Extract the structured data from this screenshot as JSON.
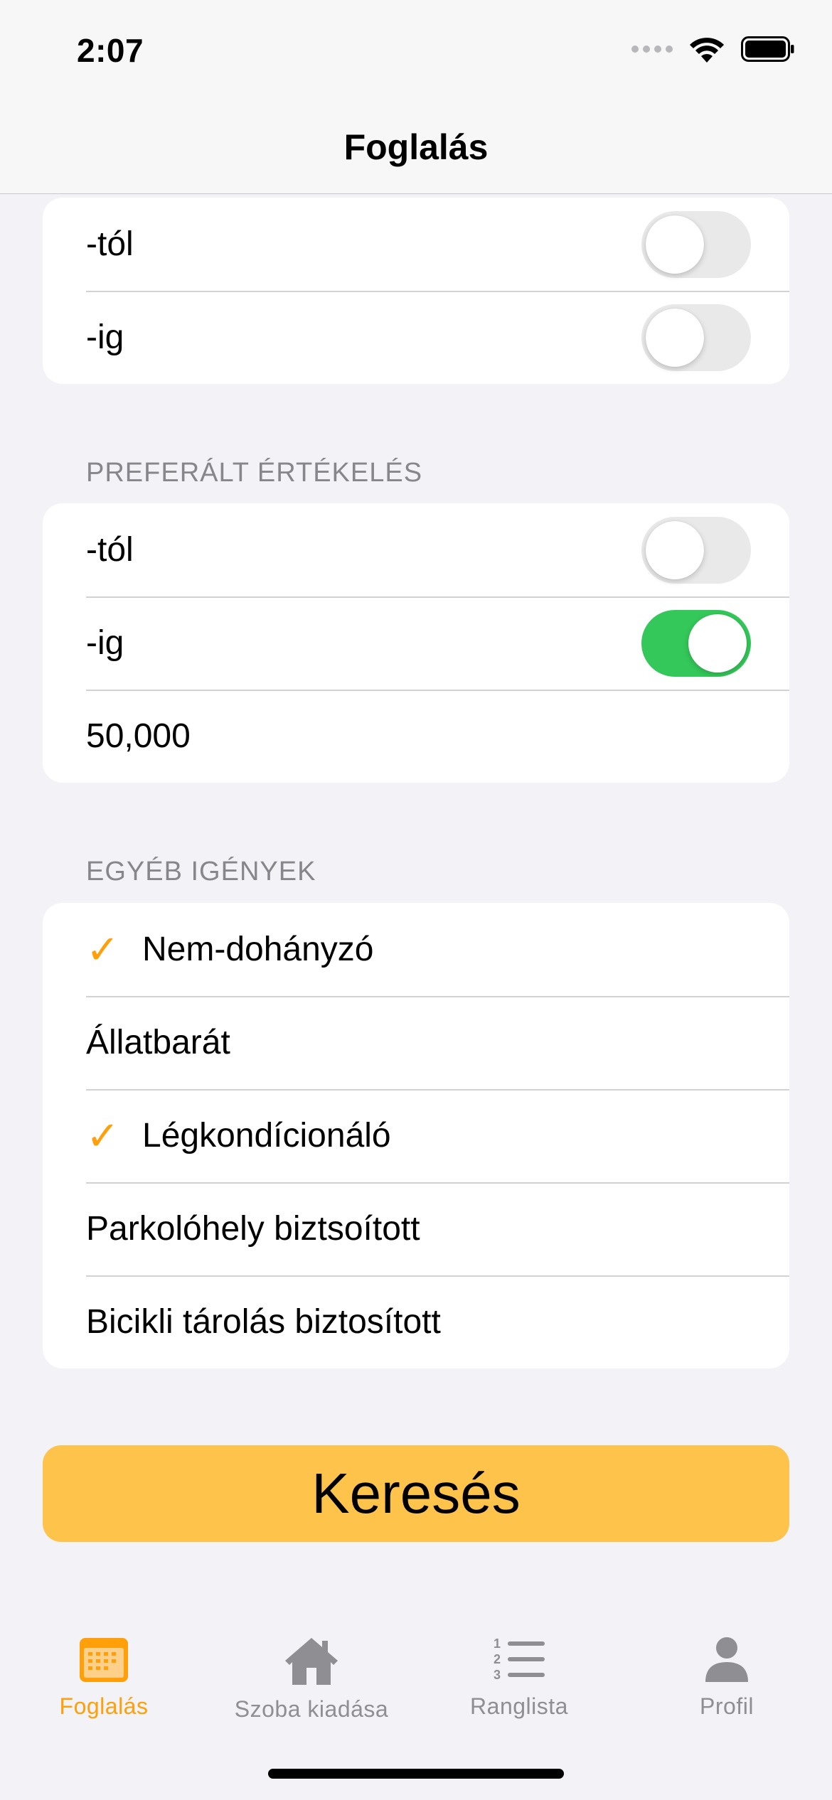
{
  "status_bar": {
    "time": "2:07"
  },
  "nav": {
    "title": "Foglalás"
  },
  "date_group": {
    "rows": [
      {
        "label": "-tól",
        "toggle_on": false
      },
      {
        "label": "-ig",
        "toggle_on": false
      }
    ]
  },
  "rating_section": {
    "header": "PREFERÁLT ÉRTÉKELÉS",
    "rows": [
      {
        "label": "-tól",
        "toggle_on": false
      },
      {
        "label": "-ig",
        "toggle_on": true
      }
    ],
    "value": "50,000"
  },
  "other_section": {
    "header": "EGYÉB IGÉNYEK",
    "items": [
      {
        "label": "Nem-dohányzó",
        "checked": true
      },
      {
        "label": "Állatbarát",
        "checked": false
      },
      {
        "label": "Légkondícionáló",
        "checked": true
      },
      {
        "label": "Parkolóhely biztsoított",
        "checked": false
      },
      {
        "label": "Bicikli tárolás biztosított",
        "checked": false
      }
    ],
    "check_glyph": "✓"
  },
  "search_button": {
    "label": "Keresés"
  },
  "tab_bar": {
    "tabs": [
      {
        "label": "Foglalás",
        "icon": "calendar-icon",
        "active": true
      },
      {
        "label": "Szoba kiadása",
        "icon": "house-icon",
        "active": false
      },
      {
        "label": "Ranglista",
        "icon": "numbered-list-icon",
        "active": false
      },
      {
        "label": "Profil",
        "icon": "person-icon",
        "active": false
      }
    ]
  },
  "colors": {
    "accent": "#ff9f0a",
    "button": "#fdc34a",
    "toggle_on": "#34c759",
    "background": "#f2f2f7"
  }
}
